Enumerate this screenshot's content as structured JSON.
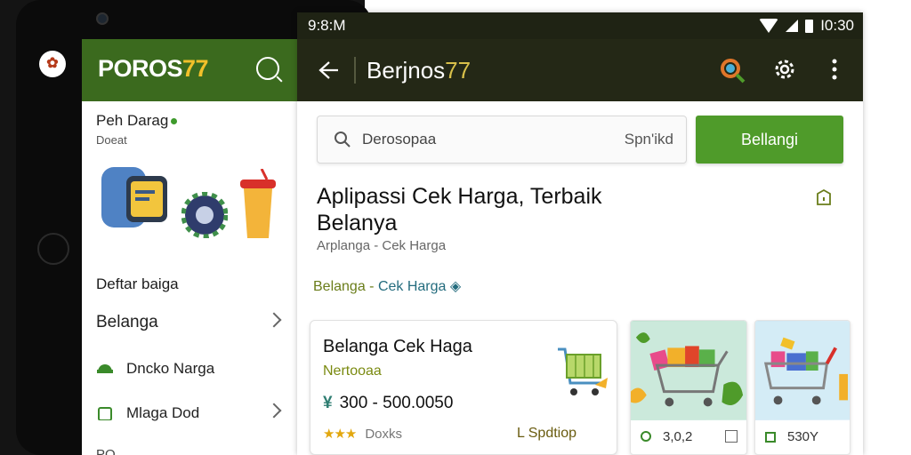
{
  "left_panel": {
    "brand_main": "POROS",
    "brand_accent": "77",
    "subtitle": "Peh Darag",
    "subtitle_sub": "Doeat",
    "section_title": "Deftar baiga",
    "items": [
      {
        "label": "Belanga",
        "icon": "none",
        "chevron": true
      },
      {
        "label": "Dncko Narga",
        "icon": "car-icon",
        "chevron": false
      },
      {
        "label": "Mlaga Dod",
        "icon": "bag-icon",
        "chevron": true
      }
    ],
    "footer_partial": "PO"
  },
  "status_bar": {
    "time": "9:8:M",
    "clock_right": "I0:30"
  },
  "app_bar": {
    "title_main": "Berjnos",
    "title_accent": "77"
  },
  "search": {
    "placeholder": "Derosopaa",
    "aux_text": "Spn'ikd"
  },
  "buy_button_label": "Bellangi",
  "headline": "Aplipassi Cek Harga, Terbaik Belanya",
  "headline_sub": "Arplanga     -  Cek Harga",
  "tagline": {
    "part1": "Belanga - ",
    "part2": "Cek Harga"
  },
  "product_card": {
    "title": "Belanga  Cek Haga",
    "subtitle": "Nertooaa",
    "currency": "¥",
    "price_range": "300 - 500.0050",
    "stars": "★★★",
    "rating_text": "Doxks",
    "link_text": "L Spdtiop"
  },
  "thumbnails": [
    {
      "footer_text": "3,0,2"
    },
    {
      "footer_text": "530Y"
    }
  ],
  "colors": {
    "left_header": "#3b6a1e",
    "app_bar": "#242816",
    "status_bar": "#1f2314",
    "buy_button": "#4f9b2a",
    "brand_accent": "#f2c02a"
  }
}
